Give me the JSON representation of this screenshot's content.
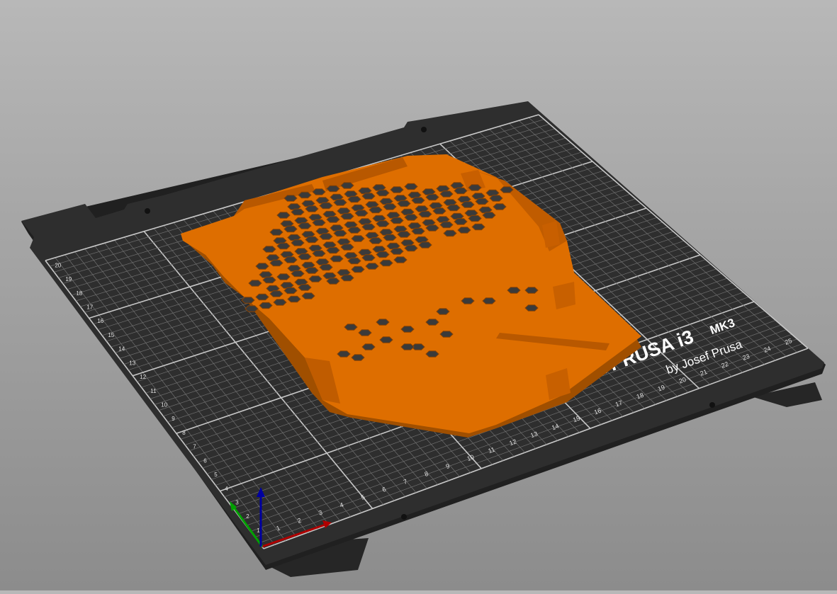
{
  "scene": {
    "bed_logo_line1": "NAL PRUSA i3",
    "bed_logo_model": "MK3",
    "bed_logo_line2": "by Josef Prusa",
    "x_axis_numbers": [
      "1",
      "2",
      "3",
      "4",
      "5",
      "6",
      "7",
      "8",
      "9",
      "10",
      "11",
      "12",
      "13",
      "14",
      "15",
      "16",
      "17",
      "18",
      "19",
      "20",
      "21",
      "22",
      "23",
      "24",
      "25"
    ],
    "y_axis_numbers": [
      "1",
      "2",
      "3",
      "4",
      "5",
      "6",
      "7",
      "8",
      "9",
      "10",
      "11",
      "12",
      "13",
      "14",
      "15",
      "16",
      "17",
      "18",
      "19",
      "20"
    ]
  },
  "colors": {
    "background_top": "#b8b8b8",
    "background_bottom": "#8c8c8c",
    "bed": "#2d2d2d",
    "grid_line": "#8a8a8a",
    "model": "#e07000",
    "axis_x": "#b00000",
    "axis_y": "#00a000",
    "axis_z": "#0000a0"
  },
  "icons": [
    "axes-gizmo-icon"
  ]
}
